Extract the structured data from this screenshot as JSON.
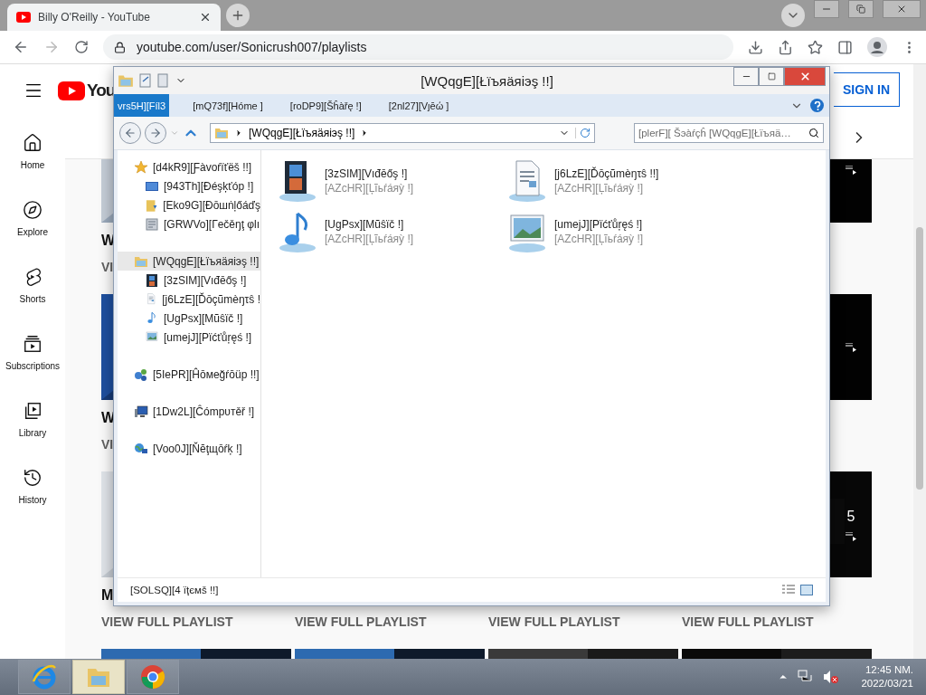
{
  "browser": {
    "tabs": [
      {
        "title": "Billy O'Reilly - YouTube",
        "selected": true
      }
    ],
    "url": "youtube.com/user/Sonicrush007/playlists"
  },
  "youtube": {
    "logo_text": "You",
    "sign_in": "SIGN IN",
    "sidebar": [
      {
        "label": "Home",
        "kind": "home"
      },
      {
        "label": "Explore",
        "kind": "explore"
      },
      {
        "label": "Shorts",
        "kind": "shorts"
      },
      {
        "label": "Subscriptions",
        "kind": "subscriptions"
      },
      {
        "label": "Library",
        "kind": "library"
      },
      {
        "label": "History",
        "kind": "history"
      }
    ],
    "rows": [
      {
        "cards": [
          {
            "kind": "playlist",
            "title": "W",
            "link": "VI"
          },
          {
            "kind": "covered"
          },
          {
            "kind": "covered"
          },
          {
            "kind": "covered"
          }
        ]
      },
      {
        "cards": [
          {
            "kind": "playlist",
            "title": "W",
            "link": "VI"
          },
          {
            "kind": "covered"
          },
          {
            "kind": "covered"
          },
          {
            "kind": "covered"
          }
        ]
      },
      {
        "cards": [
          {
            "kind": "playlist",
            "title": "M",
            "link": "VIEW FULL PLAYLIST"
          },
          {
            "kind": "covered",
            "link": "VIEW FULL PLAYLIST"
          },
          {
            "kind": "covered",
            "link": "VIEW FULL PLAYLIST"
          },
          {
            "kind": "playlist",
            "link": "VIEW FULL PLAYLIST",
            "count": "5"
          }
        ]
      },
      {
        "cards": [
          {
            "kind": "playlist"
          },
          {
            "kind": "playlist"
          },
          {
            "kind": "playlist"
          },
          {
            "kind": "playlist"
          }
        ]
      }
    ]
  },
  "explorer": {
    "title": "[WQqgE][Łïъяäяiэş !!]",
    "ribbon_tabs": [
      {
        "label": "vrs5H][Fíl3",
        "selected": true
      },
      {
        "label": "[mQ73f][Hóme ]",
        "selected": false
      },
      {
        "label": "[roDP9][Šĥàřę !]",
        "selected": false
      },
      {
        "label": "[2nl27][Vȷēώ ]",
        "selected": false
      }
    ],
    "address": "[WQqgE][Łïъяäяiэş !!]",
    "search": {
      "placeholder": "[plerF][ Šэàŕçĥ [WQqgE][Łïъяä…"
    },
    "nav": [
      {
        "label": "[d4kR9][Ƒàvoŕïťëš !!]",
        "kind": "favorites",
        "selected": false,
        "children": [
          {
            "label": "[943Th][Ðéşķťóp !]",
            "kind": "desktop",
            "selected": false
          },
          {
            "label": "[Eko9G][Ðōшṅļőáďş",
            "kind": "downloads",
            "selected": false
          },
          {
            "label": "[GRWVo][Гečěŋţ φlı",
            "kind": "recent",
            "selected": false
          }
        ]
      },
      {
        "label": "[WQqgE][Łïъяäяiэş !!]",
        "kind": "libraries",
        "selected": true,
        "children": [
          {
            "label": "[3zSIM][Vıđēőş !]",
            "kind": "videos",
            "selected": false
          },
          {
            "label": "[j6LzE][Ďōçũmèŋτŝ !",
            "kind": "documents",
            "selected": false
          },
          {
            "label": "[UgPsx][Mũŝïč !]",
            "kind": "music",
            "selected": false
          },
          {
            "label": "[umejJ][Pïćťůŗęś !]",
            "kind": "pictures",
            "selected": false
          }
        ]
      },
      {
        "label": "[5IePR][Ĥōмеğŕōüp !!]",
        "kind": "homegroup",
        "selected": false
      },
      {
        "label": "[1Dw2L][Ĉómpυтěř !]",
        "kind": "computer",
        "selected": false
      },
      {
        "label": "[Voo0J][Ňĕţщōŕķ !]",
        "kind": "network",
        "selected": false
      }
    ],
    "items": [
      {
        "name": "[3zSIM][Vıđēőş !]",
        "type": "[AZcHR][Ļĩьŕáяỳ !]",
        "kind": "videos"
      },
      {
        "name": "[j6LzE][Ďōçũmèŋτŝ !!]",
        "type": "[AZcHR][Ļĩьŕáяỳ !]",
        "kind": "documents"
      },
      {
        "name": "[UgPsx][Mũŝïč !]",
        "type": "[AZcHR][Ļĩьŕáяỳ !]",
        "kind": "music"
      },
      {
        "name": "[umejJ][Pïćťůŗęś !]",
        "type": "[AZcHR][Ļĩьŕáяỳ !]",
        "kind": "pictures"
      }
    ],
    "status": "[SOLSQ][4 ïţємš !!]"
  },
  "taskbar": {
    "apps": [
      {
        "kind": "ie",
        "selected": false
      },
      {
        "kind": "explorer",
        "selected": true
      },
      {
        "kind": "chrome",
        "selected": false
      }
    ],
    "time": "12:45 NM.",
    "date": "2022/03/21"
  }
}
